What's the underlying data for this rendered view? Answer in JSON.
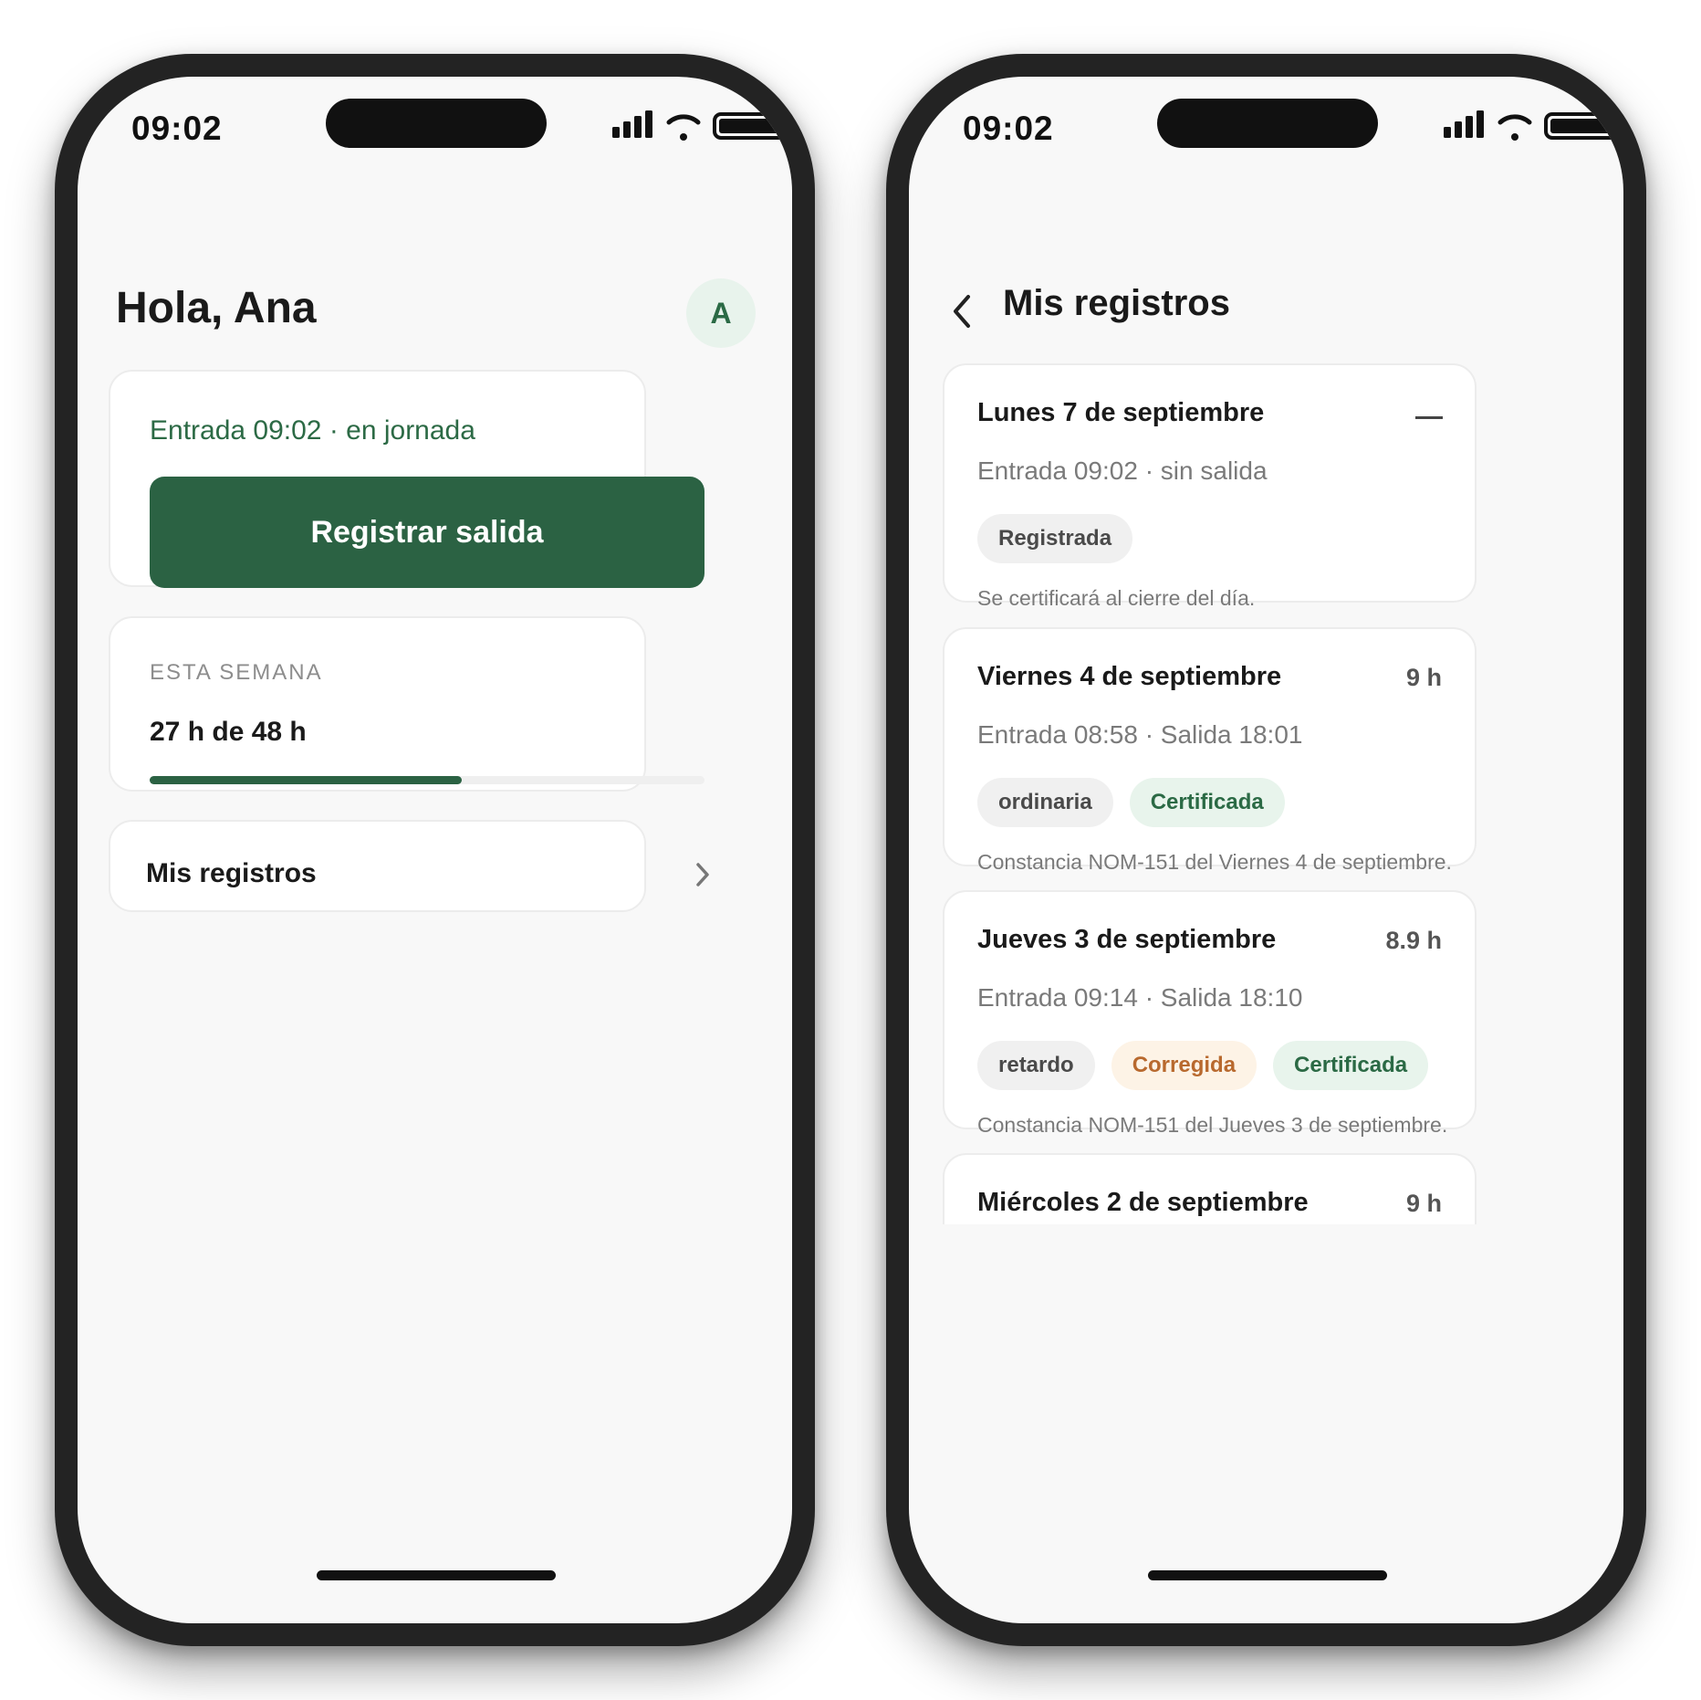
{
  "status_bar": {
    "time": "09:02"
  },
  "home": {
    "greeting": "Hola, Ana",
    "avatar_initial": "A",
    "shift_status": "Entrada 09:02 · en jornada",
    "checkout_button": "Registrar salida",
    "week": {
      "label": "ESTA SEMANA",
      "value": "27 h de 48 h",
      "progress_fraction": 0.5625
    },
    "records_link": "Mis registros"
  },
  "records": {
    "title": "Mis registros",
    "items": [
      {
        "day": "Lunes 7 de septiembre",
        "hours": "",
        "times": "Entrada 09:02 · sin salida",
        "chips": [
          {
            "label": "Registrada",
            "style": "gray"
          }
        ],
        "note": "Se certificará al cierre del día."
      },
      {
        "day": "Viernes 4 de septiembre",
        "hours": "9 h",
        "times": "Entrada 08:58 · Salida 18:01",
        "chips": [
          {
            "label": "ordinaria",
            "style": "gray"
          },
          {
            "label": "Certificada",
            "style": "green"
          }
        ],
        "note": "Constancia NOM-151 del Viernes 4 de septiembre."
      },
      {
        "day": "Jueves 3 de septiembre",
        "hours": "8.9 h",
        "times": "Entrada 09:14 · Salida 18:10",
        "chips": [
          {
            "label": "retardo",
            "style": "gray"
          },
          {
            "label": "Corregida",
            "style": "orange"
          },
          {
            "label": "Certificada",
            "style": "green"
          }
        ],
        "note": "Constancia NOM-151 del Jueves 3 de septiembre."
      },
      {
        "day": "Miércoles 2 de septiembre",
        "hours": "9 h",
        "times": "",
        "chips": [],
        "note": ""
      }
    ]
  },
  "colors": {
    "primary_green": "#2b6243",
    "accent_green_text": "#2c6a45",
    "chip_green_bg": "#e8f4ec",
    "chip_orange_bg": "#fdf3e6",
    "chip_orange_text": "#b8692e",
    "phone_frame": "#232323"
  }
}
